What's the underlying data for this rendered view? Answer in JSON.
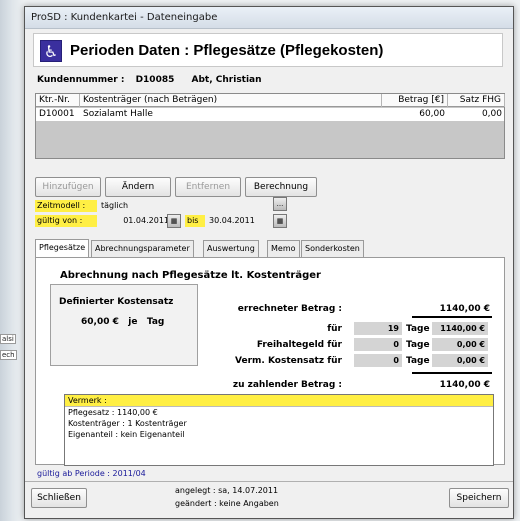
{
  "background": {
    "fragment1": "alsi",
    "fragment2": "ech"
  },
  "window": {
    "title": "ProSD : Kundenkartei - Dateneingabe"
  },
  "header": {
    "icon": "wheelchair-icon",
    "title": "Perioden Daten : Pflegesätze (Pflegekosten)"
  },
  "customer": {
    "label": "Kundennummer :",
    "number": "D10085",
    "name": "Abt, Christian"
  },
  "table": {
    "columns": [
      "Ktr.-Nr.",
      "Kostenträger (nach Beträgen)",
      "Betrag [€]",
      "Satz FHG"
    ],
    "rows": [
      {
        "ktr": "D10001",
        "kostentraeger": "Sozialamt Halle",
        "betrag": "60,00",
        "satz": "0,00"
      }
    ]
  },
  "actions": {
    "add": "Hinzufügen",
    "change": "Ändern",
    "remove": "Entfernen",
    "calc": "Berechnung"
  },
  "model": {
    "zeitmodell_label": "Zeitmodell :",
    "zeitmodell_value": "täglich",
    "more": "...",
    "gueltig_label": "gültig von :",
    "from": "01.04.2011",
    "bis_label": "bis",
    "to": "30.04.2011"
  },
  "tabs": [
    "Pflegesätze",
    "Abrechnungsparameter",
    "Auswertung",
    "Memo",
    "Sonderkosten"
  ],
  "panel": {
    "section_title": "Abrechnung nach Pflegesätze lt. Kostenträger",
    "defined_title": "Definierter Kostensatz",
    "defined_value": "60,00 €   je   Tag",
    "errechnet_label": "errechneter Betrag :",
    "errechnet_value": "1140,00 €",
    "fuer_label": "für",
    "fuer_days": "19",
    "fuer_unit": "Tage",
    "fuer_value": "1140,00 €",
    "frei_label": "Freihaltegeld für",
    "frei_days": "0",
    "frei_unit": "Tage",
    "frei_value": "0,00 €",
    "verm_label": "Verm. Kostensatz für",
    "verm_days": "0",
    "verm_unit": "Tage",
    "verm_value": "0,00 €",
    "zahlen_label": "zu zahlender Betrag :",
    "zahlen_value": "1140,00 €",
    "vermerk_title": "Vermerk :",
    "vermerk_lines": [
      "Pflegesatz : 1140,00 €",
      "Kostenträger : 1 Kostenträger",
      "Eigenanteil : kein Eigenanteil"
    ]
  },
  "footer": {
    "valid": "gültig ab Periode : 2011/04",
    "close": "Schließen",
    "created": "angelegt : sa, 14.07.2011",
    "changed": "geändert : keine Angaben",
    "save": "Speichern"
  },
  "colors": {
    "accent_yellow": "#ffef44",
    "icon_blue": "#3a2f9e",
    "footer_link": "#1a1a9a"
  }
}
